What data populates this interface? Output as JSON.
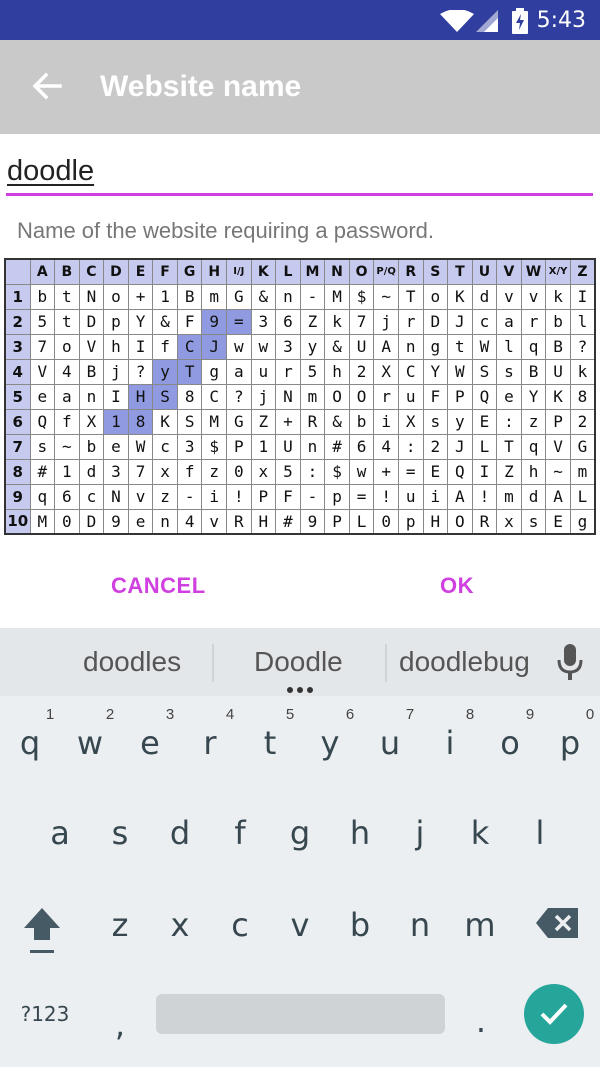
{
  "status_bar": {
    "time": "5:43"
  },
  "toolbar": {
    "title": "Website name"
  },
  "input": {
    "value": "doodle"
  },
  "helper_text": "Name of the website requiring a password.",
  "grid": {
    "columns": [
      "A",
      "B",
      "C",
      "D",
      "E",
      "F",
      "G",
      "H",
      "I/J",
      "K",
      "L",
      "M",
      "N",
      "O",
      "P/Q",
      "R",
      "S",
      "T",
      "U",
      "V",
      "W",
      "X/Y",
      "Z"
    ],
    "rows": [
      {
        "label": "1",
        "cells": [
          "b",
          "t",
          "N",
          "o",
          "+",
          "1",
          "B",
          "m",
          "G",
          "&",
          "n",
          "-",
          "M",
          "$",
          "~",
          "T",
          "o",
          "K",
          "d",
          "v",
          "v",
          "k",
          "I"
        ]
      },
      {
        "label": "2",
        "cells": [
          "5",
          "t",
          "D",
          "p",
          "Y",
          "&",
          "F",
          "9",
          "=",
          "3",
          "6",
          "Z",
          "k",
          "7",
          "j",
          "r",
          "D",
          "J",
          "c",
          "a",
          "r",
          "b",
          "l"
        ]
      },
      {
        "label": "3",
        "cells": [
          "7",
          "o",
          "V",
          "h",
          "I",
          "f",
          "C",
          "J",
          "w",
          "w",
          "3",
          "y",
          "&",
          "U",
          "A",
          "n",
          "g",
          "t",
          "W",
          "l",
          "q",
          "B",
          "?"
        ]
      },
      {
        "label": "4",
        "cells": [
          "V",
          "4",
          "B",
          "j",
          "?",
          "y",
          "T",
          "g",
          "a",
          "u",
          "r",
          "5",
          "h",
          "2",
          "X",
          "C",
          "Y",
          "W",
          "S",
          "s",
          "B",
          "U",
          "k"
        ]
      },
      {
        "label": "5",
        "cells": [
          "e",
          "a",
          "n",
          "I",
          "H",
          "S",
          "8",
          "C",
          "?",
          "j",
          "N",
          "m",
          "O",
          "O",
          "r",
          "u",
          "F",
          "P",
          "Q",
          "e",
          "Y",
          "K",
          "8"
        ]
      },
      {
        "label": "6",
        "cells": [
          "Q",
          "f",
          "X",
          "1",
          "8",
          "K",
          "S",
          "M",
          "G",
          "Z",
          "+",
          "R",
          "&",
          "b",
          "i",
          "X",
          "s",
          "y",
          "E",
          ":",
          "z",
          "P",
          "2"
        ]
      },
      {
        "label": "7",
        "cells": [
          "s",
          "~",
          "b",
          "e",
          "W",
          "c",
          "3",
          "$",
          "P",
          "1",
          "U",
          "n",
          "#",
          "6",
          "4",
          ":",
          "2",
          "J",
          "L",
          "T",
          "q",
          "V",
          "G"
        ]
      },
      {
        "label": "8",
        "cells": [
          "#",
          "1",
          "d",
          "3",
          "7",
          "x",
          "f",
          "z",
          "0",
          "x",
          "5",
          ":",
          "$",
          "w",
          "+",
          "=",
          "E",
          "Q",
          "I",
          "Z",
          "h",
          "~",
          "m"
        ]
      },
      {
        "label": "9",
        "cells": [
          "q",
          "6",
          "c",
          "N",
          "v",
          "z",
          "-",
          "i",
          "!",
          "P",
          "F",
          "-",
          "p",
          "=",
          "!",
          "u",
          "i",
          "A",
          "!",
          "m",
          "d",
          "A",
          "L"
        ]
      },
      {
        "label": "10",
        "cells": [
          "M",
          "0",
          "D",
          "9",
          "e",
          "n",
          "4",
          "v",
          "R",
          "H",
          "#",
          "9",
          "P",
          "L",
          "0",
          "p",
          "H",
          "O",
          "R",
          "x",
          "s",
          "E",
          "g"
        ]
      }
    ],
    "highlighted": [
      [
        2,
        7
      ],
      [
        2,
        8
      ],
      [
        3,
        6
      ],
      [
        3,
        7
      ],
      [
        4,
        5
      ],
      [
        4,
        6
      ],
      [
        5,
        4
      ],
      [
        5,
        5
      ],
      [
        6,
        3
      ],
      [
        6,
        4
      ]
    ]
  },
  "dialog": {
    "cancel": "CANCEL",
    "ok": "OK"
  },
  "keyboard": {
    "suggestions": [
      "doodles",
      "Doodle",
      "doodlebug"
    ],
    "row1": [
      "q",
      "w",
      "e",
      "r",
      "t",
      "y",
      "u",
      "i",
      "o",
      "p"
    ],
    "row1_hints": [
      "1",
      "2",
      "3",
      "4",
      "5",
      "6",
      "7",
      "8",
      "9",
      "0"
    ],
    "row2": [
      "a",
      "s",
      "d",
      "f",
      "g",
      "h",
      "j",
      "k",
      "l"
    ],
    "row3": [
      "z",
      "x",
      "c",
      "v",
      "b",
      "n",
      "m"
    ],
    "symbols_key": "?123",
    "comma": ",",
    "period": "."
  },
  "colors": {
    "accent": "#d040e0",
    "status_bar": "#303f9f",
    "toolbar": "#c9c9c9",
    "grid_header": "#c6caee",
    "grid_highlight": "#8f9ae0",
    "enter_key": "#26a69a"
  }
}
